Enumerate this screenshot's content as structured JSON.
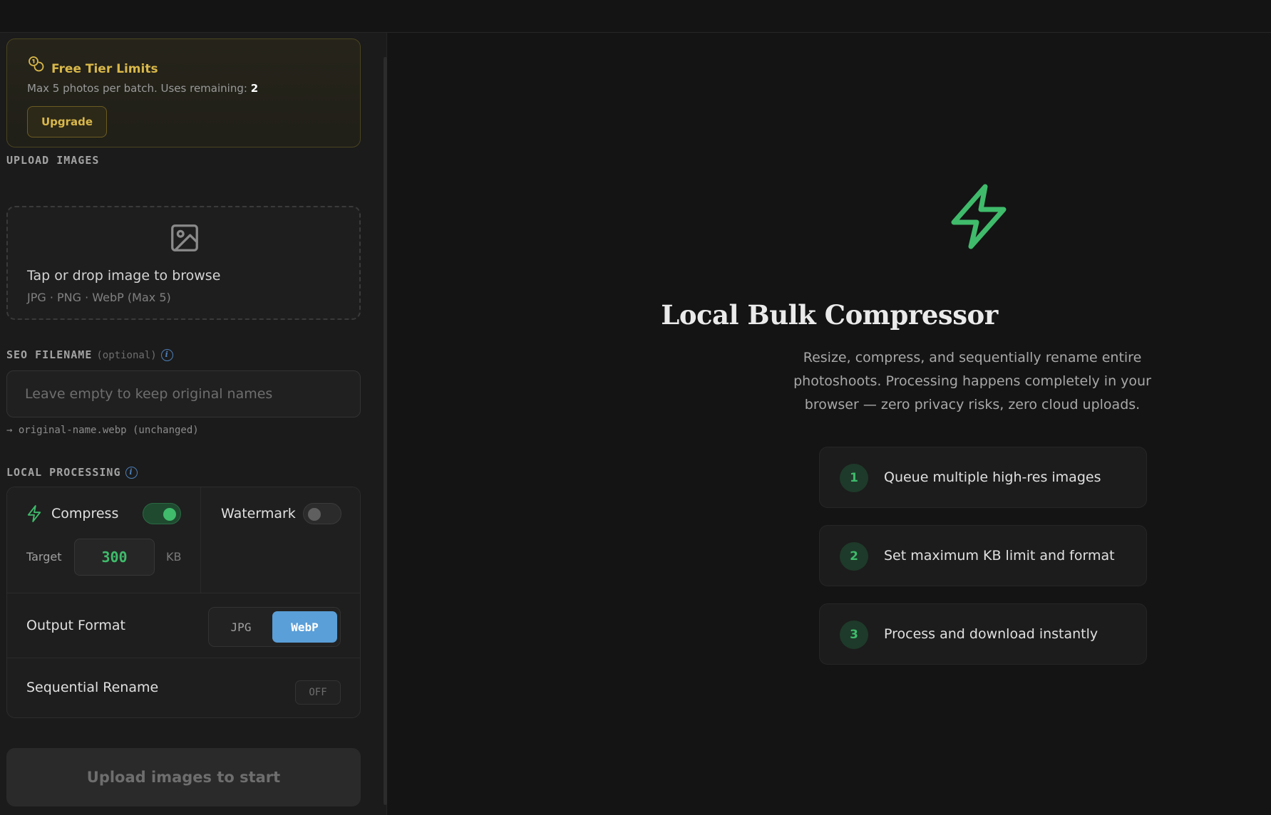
{
  "tier": {
    "title": "Free Tier Limits",
    "desc": "Max 5 photos per batch. Uses remaining: ",
    "remaining": "2",
    "upgrade_label": "Upgrade"
  },
  "upload": {
    "section_label": "UPLOAD IMAGES",
    "title": "Tap or drop image to browse",
    "subtitle": "JPG · PNG · WebP (Max 5)"
  },
  "seo": {
    "section_label": "SEO FILENAME",
    "optional_label": "(optional)",
    "placeholder": "Leave empty to keep original names",
    "value": "",
    "preview": "→ original-name.webp (unchanged)"
  },
  "processing": {
    "section_label": "LOCAL PROCESSING",
    "compress_label": "Compress",
    "compress_on": true,
    "watermark_label": "Watermark",
    "watermark_on": false,
    "target_label": "Target",
    "target_value": "300",
    "target_unit": "KB",
    "output_format_label": "Output Format",
    "formats": [
      "JPG",
      "WebP"
    ],
    "selected_format": "WebP",
    "rename_label": "Sequential Rename",
    "rename_state": "OFF"
  },
  "start_button": "Upload images to start",
  "hero": {
    "title": "Local Bulk Compressor",
    "description": "Resize, compress, and sequentially rename entire photoshoots. Processing happens completely in your browser — zero privacy risks, zero cloud uploads."
  },
  "steps": [
    {
      "num": "1",
      "text": "Queue multiple high-res images"
    },
    {
      "num": "2",
      "text": "Set maximum KB limit and format"
    },
    {
      "num": "3",
      "text": "Process and download instantly"
    }
  ],
  "colors": {
    "accent_green": "#3fbb6b",
    "accent_blue": "#5a9fd8",
    "tier_gold": "#d9b84a",
    "background": "#141414"
  }
}
